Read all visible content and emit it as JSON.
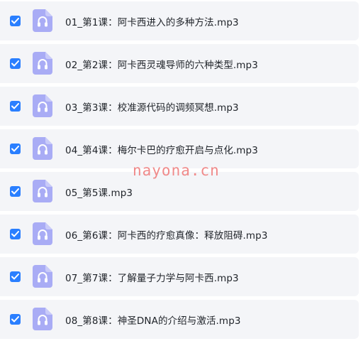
{
  "colors": {
    "checkbox": "#2a7fff",
    "icon_bg": "#a9acf5",
    "row_bg": "#f4f5f8",
    "watermark": "#f08a8a"
  },
  "files": [
    {
      "name": "01_第1课：阿卡西进入的多种方法.mp3",
      "checked": true,
      "icon": "headphones-icon"
    },
    {
      "name": "02_第2课：阿卡西灵魂导师的六种类型.mp3",
      "checked": true,
      "icon": "headphones-icon"
    },
    {
      "name": "03_第3课：校准源代码的调频冥想.mp3",
      "checked": true,
      "icon": "headphones-icon"
    },
    {
      "name": "04_第4课：梅尔卡巴的疗愈开启与点化.mp3",
      "checked": true,
      "icon": "headphones-icon"
    },
    {
      "name": "05_第5课.mp3",
      "checked": true,
      "icon": "headphones-icon"
    },
    {
      "name": "06_第6课：阿卡西的疗愈真像：释放阻碍.mp3",
      "checked": true,
      "icon": "headphones-icon"
    },
    {
      "name": "07_第7课：了解量子力学与阿卡西.mp3",
      "checked": true,
      "icon": "headphones-icon"
    },
    {
      "name": "08_第8课：神圣DNA的介绍与激活.mp3",
      "checked": true,
      "icon": "headphones-icon"
    }
  ],
  "watermark": "nayona.cn"
}
